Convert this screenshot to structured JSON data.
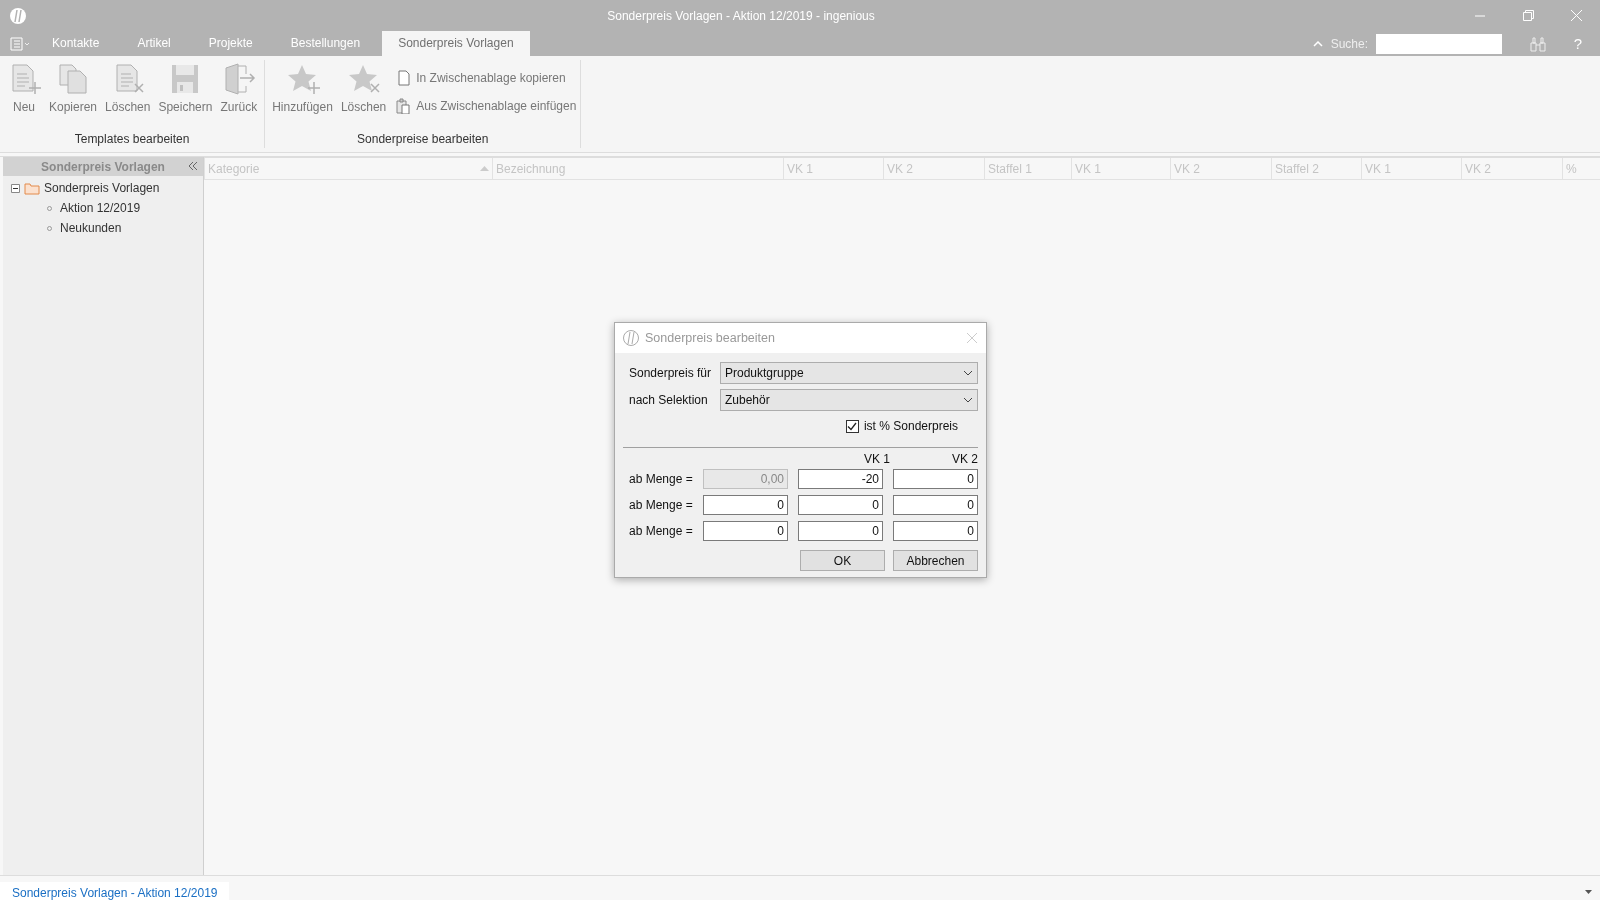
{
  "window": {
    "title": "Sonderpreis Vorlagen - Aktion 12/2019 - ingenious"
  },
  "menu_tabs": [
    {
      "label": "Kontakte",
      "selected": false
    },
    {
      "label": "Artikel",
      "selected": false
    },
    {
      "label": "Projekte",
      "selected": false
    },
    {
      "label": "Bestellungen",
      "selected": false
    },
    {
      "label": "Sonderpreis Vorlagen",
      "selected": true
    }
  ],
  "search": {
    "label": "Suche:",
    "help": "?"
  },
  "ribbon_groups": [
    {
      "title": "Templates bearbeiten",
      "items": [
        {
          "label": "Neu",
          "kind": "new"
        },
        {
          "label": "Kopieren",
          "kind": "copy"
        },
        {
          "label": "Löschen",
          "kind": "delete"
        },
        {
          "label": "Speichern",
          "kind": "save"
        },
        {
          "label": "Zurück",
          "kind": "back"
        }
      ]
    },
    {
      "title": "Sonderpreise bearbeiten",
      "items": [
        {
          "label": "Hinzufügen",
          "kind": "star-add"
        },
        {
          "label": "Löschen",
          "kind": "star-delete"
        },
        {
          "label": "In Zwischenablage kopieren",
          "kind": "small-copy"
        },
        {
          "label": "Aus Zwischenablage einfügen",
          "kind": "small-paste"
        }
      ]
    }
  ],
  "sidebar": {
    "title": "Sonderpreis Vorlagen",
    "tree": [
      {
        "label": "Sonderpreis Vorlagen",
        "expanded": true,
        "children": [
          {
            "label": "Aktion 12/2019"
          },
          {
            "label": "Neukunden"
          }
        ]
      }
    ]
  },
  "grid": {
    "columns": [
      {
        "label": "Kategorie",
        "sorted": true
      },
      {
        "label": "Bezeichnung",
        "sorted": false
      },
      {
        "label": "VK 1",
        "sorted": false
      },
      {
        "label": "VK 2",
        "sorted": false
      },
      {
        "label": "Staffel 1",
        "sorted": false
      },
      {
        "label": "VK 1",
        "sorted": false
      },
      {
        "label": "VK 2",
        "sorted": false
      },
      {
        "label": "Staffel 2",
        "sorted": false
      },
      {
        "label": "VK 1",
        "sorted": false
      },
      {
        "label": "VK 2",
        "sorted": false
      },
      {
        "label": "%",
        "sorted": false
      }
    ]
  },
  "dialog": {
    "title": "Sonderpreis bearbeiten",
    "fields": [
      {
        "label": "Sonderpreis für",
        "value": "Produktgruppe"
      },
      {
        "label": "nach Selektion",
        "value": "Zubehör"
      }
    ],
    "checkbox": {
      "label": "ist % Sonderpreis",
      "checked": true
    },
    "columns": [
      "VK 1",
      "VK 2"
    ],
    "rows": [
      {
        "label": "ab Menge =",
        "values": [
          {
            "value": "0,00",
            "disabled": true
          },
          {
            "value": "-20",
            "disabled": false
          },
          {
            "value": "0",
            "disabled": false
          }
        ]
      },
      {
        "label": "ab Menge =",
        "values": [
          {
            "value": "0",
            "disabled": false
          },
          {
            "value": "0",
            "disabled": false
          },
          {
            "value": "0",
            "disabled": false
          }
        ]
      },
      {
        "label": "ab Menge =",
        "values": [
          {
            "value": "0",
            "disabled": false
          },
          {
            "value": "0",
            "disabled": false
          },
          {
            "value": "0",
            "disabled": false
          }
        ]
      }
    ],
    "buttons": [
      "OK",
      "Abbrechen"
    ]
  },
  "bottom_tabs": [
    {
      "label": "Sonderpreis Vorlagen - Aktion 12/2019",
      "selected": true
    }
  ]
}
